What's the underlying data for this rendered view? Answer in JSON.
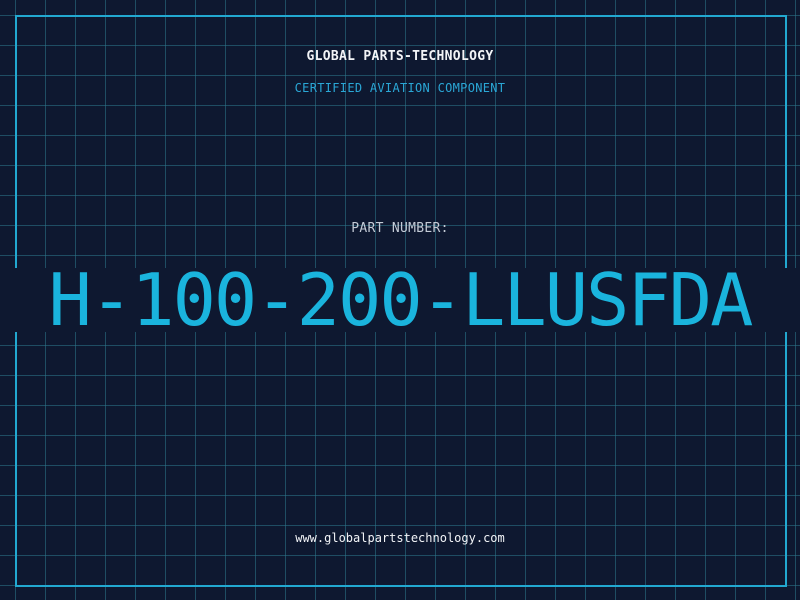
{
  "header": {
    "brand": "GLOBAL PARTS-TECHNOLOGY",
    "subtitle": "CERTIFIED AVIATION COMPONENT"
  },
  "part": {
    "label": "PART NUMBER:",
    "number": "H-100-200-LLUSFDA"
  },
  "footer": {
    "url": "www.globalpartstechnology.com"
  },
  "colors": {
    "background": "#0e1830",
    "grid": "#2e788c",
    "frame": "#22a8d0",
    "accent": "#1ab4dd",
    "text": "#f2f4f7"
  }
}
